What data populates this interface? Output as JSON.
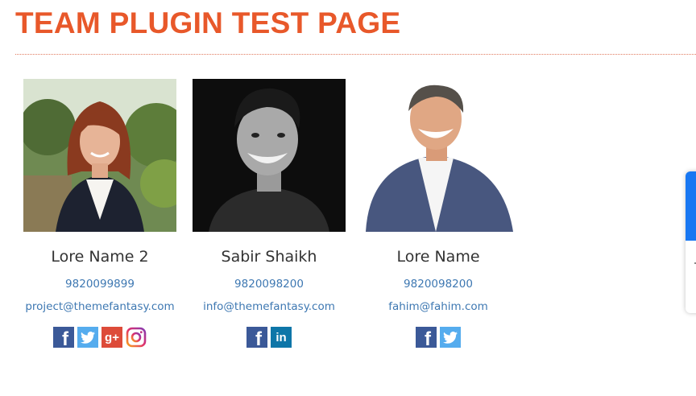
{
  "page": {
    "title": "TEAM PLUGIN TEST PAGE"
  },
  "members": [
    {
      "name": "Lore Name 2",
      "phone": "9820099899",
      "email": "project@themefantasy.com",
      "socials": [
        "facebook-icon",
        "twitter-icon",
        "google-plus-icon",
        "instagram-icon"
      ]
    },
    {
      "name": "Sabir Shaikh",
      "phone": "9820098200",
      "email": "info@themefantasy.com",
      "socials": [
        "facebook-icon",
        "linkedin-icon"
      ]
    },
    {
      "name": "Lore Name",
      "phone": "9820098200",
      "email": "fahim@fahim.com",
      "socials": [
        "facebook-icon",
        "twitter-icon"
      ]
    }
  ],
  "colors": {
    "title": "#e8582a",
    "link": "#3e78b2",
    "facebook": "#3b5998",
    "twitter": "#55acee",
    "google_plus": "#dd4b39",
    "linkedin": "#0e76a8"
  }
}
